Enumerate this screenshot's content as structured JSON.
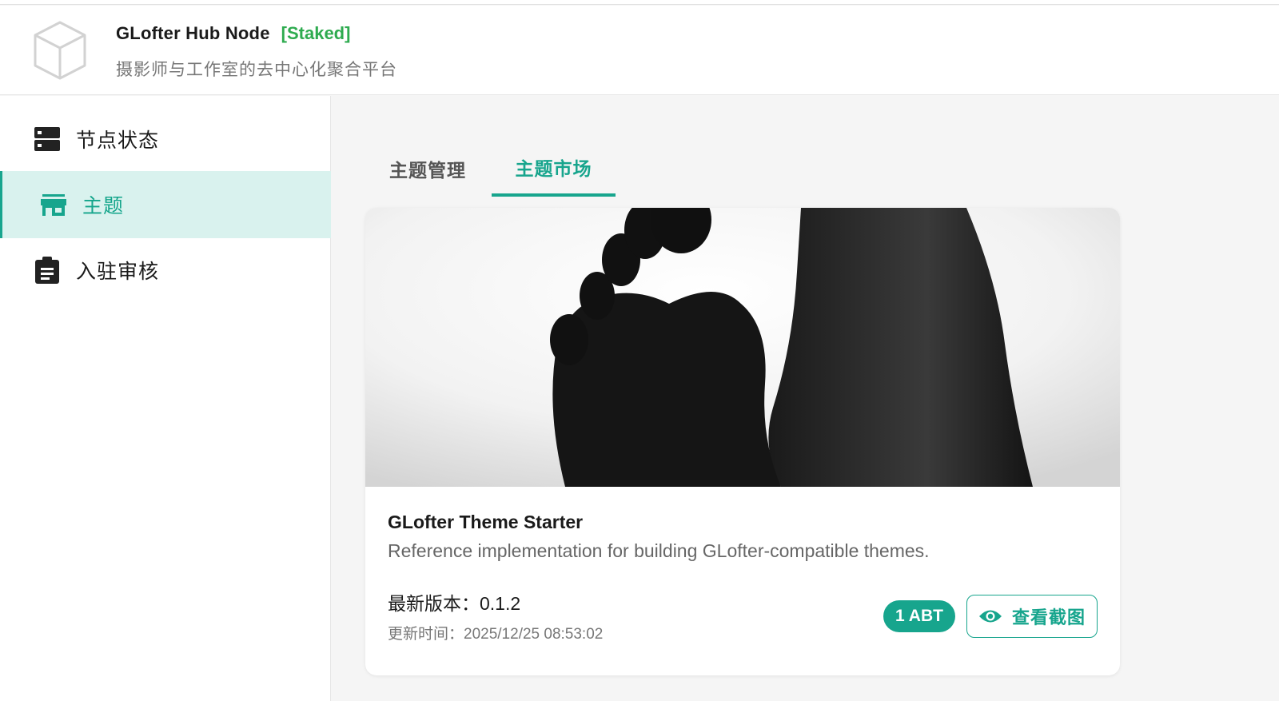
{
  "header": {
    "title": "GLofter Hub Node",
    "status": "[Staked]",
    "subtitle": "摄影师与工作室的去中心化聚合平台"
  },
  "sidebar": {
    "items": [
      {
        "label": "节点状态",
        "icon": "server-icon"
      },
      {
        "label": "主题",
        "icon": "storefront-icon",
        "active": true
      },
      {
        "label": "入驻审核",
        "icon": "clipboard-icon"
      }
    ]
  },
  "tabs": [
    {
      "label": "主题管理"
    },
    {
      "label": "主题市场",
      "active": true
    }
  ],
  "theme_card": {
    "title": "GLofter Theme Starter",
    "description": "Reference implementation for building GLofter-compatible themes.",
    "version_label": "最新版本：",
    "version": "0.1.2",
    "updated_label": "更新时间：",
    "updated": "2025/12/25 08:53:02",
    "price": "1 ABT",
    "screenshots_label": "查看截图"
  },
  "colors": {
    "accent": "#17a58d",
    "status": "#2eab4f",
    "active_bg": "#d9f2ee"
  }
}
